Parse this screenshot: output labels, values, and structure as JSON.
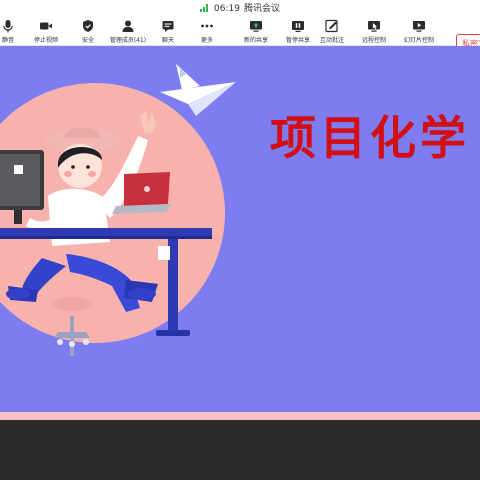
{
  "titlebar": {
    "time": "06:19",
    "app_title": "腾讯会议"
  },
  "toolbar": {
    "items": [
      {
        "label": "静音",
        "icon": "mic-icon"
      },
      {
        "label": "停止视频",
        "icon": "video-camera-icon"
      },
      {
        "label": "安全",
        "icon": "shield-icon"
      },
      {
        "label": "管理成员(41)",
        "icon": "members-icon"
      },
      {
        "label": "聊天",
        "icon": "chat-icon"
      },
      {
        "label": "更多",
        "icon": "more-dots-icon"
      },
      {
        "label": "新的共享",
        "icon": "share-screen-icon"
      },
      {
        "label": "暂停共享",
        "icon": "pause-icon"
      },
      {
        "label": "互动批注",
        "icon": "annotate-icon"
      },
      {
        "label": "远程控制",
        "icon": "remote-control-icon"
      },
      {
        "label": "幻灯片控制",
        "icon": "slideshow-icon"
      }
    ],
    "private_chat": "私密文字"
  },
  "slide": {
    "title": "项目化学"
  },
  "colors": {
    "slide_bg": "#7d7cf0",
    "title_red": "#d20f14",
    "circle_pink": "#f8b2ae",
    "accent_green": "#2db84d",
    "chat_red": "#e0433b"
  }
}
